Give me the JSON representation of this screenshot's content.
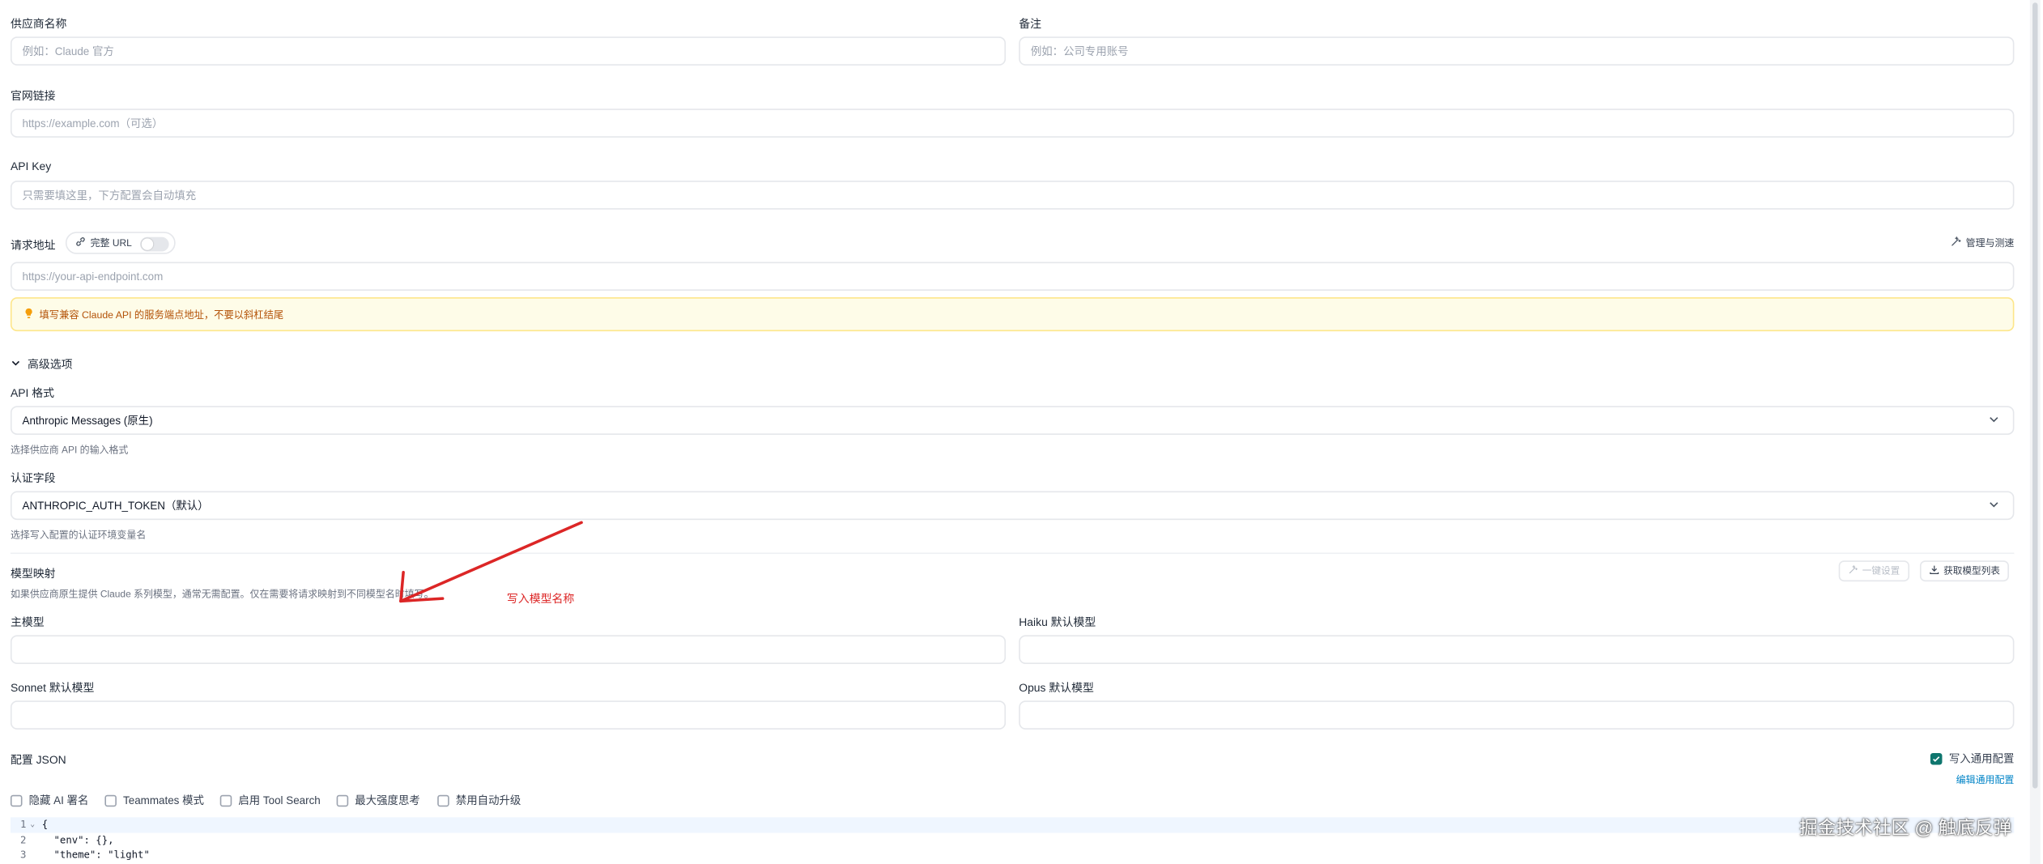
{
  "form": {
    "name_label": "供应商名称",
    "name_placeholder": "例如：Claude 官方",
    "notes_label": "备注",
    "notes_placeholder": "例如：公司专用账号",
    "website_label": "官网链接",
    "website_placeholder": "https://example.com（可选）",
    "apikey_label": "API Key",
    "apikey_placeholder": "只需要填这里，下方配置会自动填充",
    "endpoint_label": "请求地址",
    "full_url_label": "完整 URL",
    "full_url_enabled": false,
    "manage_label": "管理与测速",
    "endpoint_placeholder": "https://your-api-endpoint.com",
    "endpoint_tip": "填写兼容 Claude API 的服务端点地址，不要以斜杠结尾"
  },
  "advanced": {
    "toggle_label": "高级选项",
    "api_format_label": "API 格式",
    "api_format_value": "Anthropic Messages (原生)",
    "api_format_hint": "选择供应商 API 的输入格式",
    "auth_field_label": "认证字段",
    "auth_field_value": "ANTHROPIC_AUTH_TOKEN（默认）",
    "auth_field_hint": "选择写入配置的认证环境变量名"
  },
  "model_mapping": {
    "title": "模型映射",
    "description": "如果供应商原生提供 Claude 系列模型，通常无需配置。仅在需要将请求映射到不同模型名时填写。",
    "one_click_label": "一键设置",
    "fetch_label": "获取模型列表",
    "main_label": "主模型",
    "haiku_label": "Haiku 默认模型",
    "sonnet_label": "Sonnet 默认模型",
    "opus_label": "Opus 默认模型"
  },
  "annotation": {
    "text": "写入模型名称",
    "color": "#dc2626"
  },
  "config": {
    "title": "配置 JSON",
    "write_common_label": "写入通用配置",
    "write_common_checked": true,
    "edit_common_label": "编辑通用配置",
    "options": [
      {
        "label": "隐藏 AI 署名",
        "checked": false
      },
      {
        "label": "Teammates 模式",
        "checked": false
      },
      {
        "label": "启用 Tool Search",
        "checked": false
      },
      {
        "label": "最大强度思考",
        "checked": false
      },
      {
        "label": "禁用自动升级",
        "checked": false
      }
    ],
    "code_lines": [
      {
        "n": "1",
        "fold": "⌄",
        "text": "{"
      },
      {
        "n": "2",
        "fold": "",
        "text": "  \"env\": {},"
      },
      {
        "n": "3",
        "fold": "",
        "text": "  \"theme\": \"light\""
      }
    ]
  },
  "watermark": "掘金技术社区 @ 触底反弹",
  "colors": {
    "accent": "#0f766e",
    "link": "#0284c7",
    "warning_bg": "#fefce8",
    "warning_text": "#b45309"
  }
}
